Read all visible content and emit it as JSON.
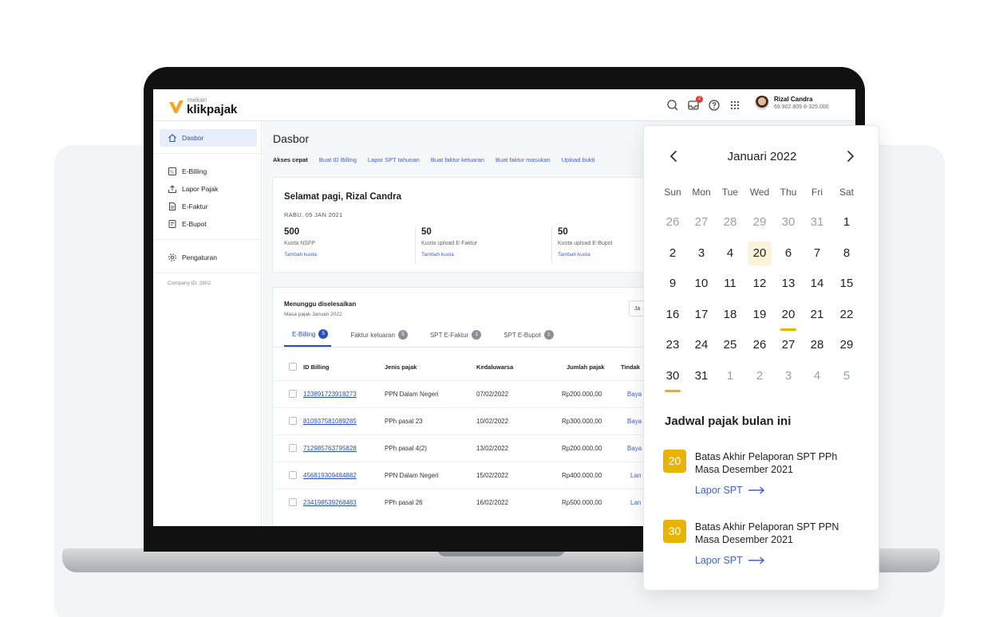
{
  "header": {
    "logo_small": "mekari",
    "logo_main": "klikpajak",
    "notification_count": "2",
    "user_name": "Rizal Candra",
    "user_npwp": "69.902.809.8-325.000"
  },
  "sidebar": {
    "items": [
      {
        "label": "Dasbor",
        "icon": "home-icon"
      },
      {
        "label": "E-Billing",
        "icon": "billing-icon"
      },
      {
        "label": "Lapor Pajak",
        "icon": "upload-icon"
      },
      {
        "label": "E-Faktur",
        "icon": "document-icon"
      },
      {
        "label": "E-Bupot",
        "icon": "receipt-icon"
      },
      {
        "label": "Pengaturan",
        "icon": "gear-icon"
      }
    ],
    "company_id": "Company ID: 2802"
  },
  "main": {
    "title": "Dasbor",
    "quick_label": "Akses cepat",
    "quick_links": [
      "Buat ID Billing",
      "Lapor SPT tahunan",
      "Buat faktur keluaran",
      "Buat faktur masukan",
      "Upload bukti"
    ],
    "greeting": "Selamat pagi, Rizal Candra",
    "date": "RABU, 05 JAN 2021",
    "stats": [
      {
        "value": "500",
        "label": "Kuota NSFP",
        "link": "Tambah kuota"
      },
      {
        "value": "50",
        "label": "Kuota upload E-Faktur",
        "link": "Tambah kuota"
      },
      {
        "value": "50",
        "label": "Kuota upload E-Bupot",
        "link": "Tambah kuota"
      }
    ],
    "pending_title": "Menunggu diselesaikan",
    "pending_sub": "Masa pajak Januari 2022",
    "filter_value": "Ja",
    "tabs": [
      {
        "label": "E-Billing",
        "count": "5"
      },
      {
        "label": "Faktur keluaran",
        "count": "5"
      },
      {
        "label": "SPT E-Faktur",
        "count": "1"
      },
      {
        "label": "SPT E-Bupot",
        "count": "1"
      }
    ],
    "table": {
      "headers": [
        "ID Billing",
        "Jenis pajak",
        "Kedaluwarsa",
        "Jumlah pajak",
        "Tindak"
      ],
      "rows": [
        {
          "id": "123891723918273",
          "jenis": "PPN Dalam Negeri",
          "exp": "07/02/2022",
          "amount": "Rp200.000,00",
          "action": "Baya"
        },
        {
          "id": "810937581089285",
          "jenis": "PPh pasal 23",
          "exp": "10/02/2022",
          "amount": "Rp300.000,00",
          "action": "Baya"
        },
        {
          "id": "712985763795828",
          "jenis": "PPh pasal 4(2)",
          "exp": "13/02/2022",
          "amount": "Rp200.000,00",
          "action": "Baya"
        },
        {
          "id": "456819309484882",
          "jenis": "PPN Dalam Negeri",
          "exp": "15/02/2022",
          "amount": "Rp400.000,00",
          "action": "Lan"
        },
        {
          "id": "234198539268483",
          "jenis": "PPh pasal 26",
          "exp": "16/02/2022",
          "amount": "Rp500.000,00",
          "action": "Lan"
        }
      ]
    }
  },
  "calendar": {
    "month": "Januari 2022",
    "weekdays": [
      "Sun",
      "Mon",
      "Tue",
      "Wed",
      "Thu",
      "Fri",
      "Sat"
    ],
    "weeks": [
      [
        "26",
        "27",
        "28",
        "29",
        "30",
        "31",
        "1"
      ],
      [
        "2",
        "3",
        "4",
        "20",
        "6",
        "7",
        "8"
      ],
      [
        "9",
        "10",
        "11",
        "12",
        "13",
        "14",
        "15"
      ],
      [
        "16",
        "17",
        "18",
        "19",
        "20",
        "21",
        "22"
      ],
      [
        "23",
        "24",
        "25",
        "26",
        "27",
        "28",
        "29"
      ],
      [
        "30",
        "31",
        "1",
        "2",
        "3",
        "4",
        "5"
      ]
    ],
    "muted_days": [
      [
        0,
        0
      ],
      [
        0,
        1
      ],
      [
        0,
        2
      ],
      [
        0,
        3
      ],
      [
        0,
        4
      ],
      [
        0,
        5
      ],
      [
        5,
        2
      ],
      [
        5,
        3
      ],
      [
        5,
        4
      ],
      [
        5,
        5
      ],
      [
        5,
        6
      ]
    ],
    "highlighted_day": [
      1,
      3
    ],
    "marked_days": [
      [
        3,
        4
      ],
      [
        5,
        0
      ]
    ],
    "accent_color": "#e8b400"
  },
  "schedule": {
    "title": "Jadwal pajak bulan ini",
    "items": [
      {
        "day": "20",
        "text": "Batas Akhir Pelaporan SPT PPh Masa Desember 2021",
        "link": "Lapor SPT"
      },
      {
        "day": "30",
        "text": "Batas Akhir Pelaporan SPT PPN Masa Desember 2021",
        "link": "Lapor SPT"
      }
    ]
  }
}
